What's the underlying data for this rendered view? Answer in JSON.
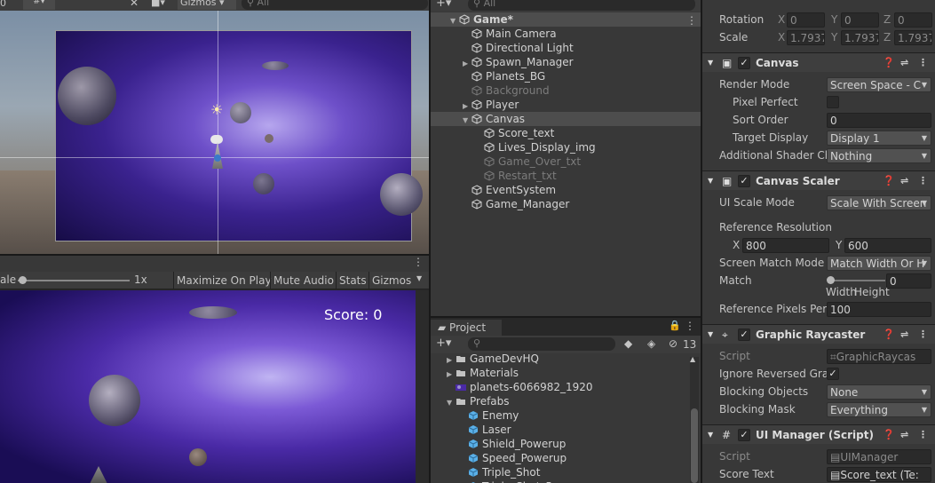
{
  "scene": {
    "toolbar": {
      "count": "0",
      "gizmos": "Gizmos"
    }
  },
  "game": {
    "toolbar": {
      "scale_prefix": "ale",
      "scale_value": "1x",
      "maximize": "Maximize On Play",
      "mute": "Mute Audio",
      "stats": "Stats",
      "gizmos": "Gizmos"
    },
    "score": "Score: 0"
  },
  "hierarchy": {
    "search_placeholder": "All",
    "items": [
      {
        "label": "Game*",
        "depth": 0
      },
      {
        "label": "Main Camera",
        "depth": 1
      },
      {
        "label": "Directional Light",
        "depth": 1
      },
      {
        "label": "Spawn_Manager",
        "depth": 1
      },
      {
        "label": "Planets_BG",
        "depth": 1
      },
      {
        "label": "Background",
        "depth": 1
      },
      {
        "label": "Player",
        "depth": 1
      },
      {
        "label": "Canvas",
        "depth": 1
      },
      {
        "label": "Score_text",
        "depth": 2
      },
      {
        "label": "Lives_Display_img",
        "depth": 2
      },
      {
        "label": "Game_Over_txt",
        "depth": 2
      },
      {
        "label": "Restart_txt",
        "depth": 2
      },
      {
        "label": "EventSystem",
        "depth": 1
      },
      {
        "label": "Game_Manager",
        "depth": 1
      }
    ]
  },
  "project": {
    "tab": "Project",
    "hidden_count": "13",
    "items": [
      {
        "label": "GameDevHQ"
      },
      {
        "label": "Materials"
      },
      {
        "label": "planets-6066982_1920"
      },
      {
        "label": "Prefabs"
      },
      {
        "label": "Enemy"
      },
      {
        "label": "Laser"
      },
      {
        "label": "Shield_Powerup"
      },
      {
        "label": "Speed_Powerup"
      },
      {
        "label": "Triple_Shot"
      },
      {
        "label": "Triple_Shot_Powerup"
      }
    ]
  },
  "inspector": {
    "rotation": {
      "label": "Rotation",
      "x": "0",
      "y": "0",
      "z": "0"
    },
    "scale": {
      "label": "Scale",
      "x": "1.7937",
      "y": "1.7937",
      "z": "1.7937"
    },
    "axis": {
      "x": "X",
      "y": "Y",
      "z": "Z"
    },
    "canvas": {
      "title": "Canvas",
      "render_mode_label": "Render Mode",
      "render_mode": "Screen Space - C",
      "pixel_perfect_label": "Pixel Perfect",
      "sort_order_label": "Sort Order",
      "sort_order": "0",
      "target_display_label": "Target Display",
      "target_display": "Display 1",
      "shader_label": "Additional Shader Ch",
      "shader": "Nothing"
    },
    "scaler": {
      "title": "Canvas Scaler",
      "mode_label": "UI Scale Mode",
      "mode": "Scale With Screen",
      "ref_label": "Reference Resolution",
      "ref_x": "800",
      "ref_y": "600",
      "match_mode_label": "Screen Match Mode",
      "match_mode": "Match Width Or H",
      "match_label": "Match",
      "match_value": "0",
      "match_level": 0.0,
      "width_label": "Width",
      "height_label": "Height",
      "ppu_label": "Reference Pixels Per",
      "ppu": "100"
    },
    "raycaster": {
      "title": "Graphic Raycaster",
      "script_label": "Script",
      "script": "GraphicRaycas",
      "ignore_label": "Ignore Reversed Grap",
      "blocking_objects_label": "Blocking Objects",
      "blocking_objects": "None",
      "blocking_mask_label": "Blocking Mask",
      "blocking_mask": "Everything"
    },
    "ui_manager": {
      "title": "UI Manager (Script)",
      "script_label": "Script",
      "script": "UIManager",
      "score_text_label": "Score Text",
      "score_text": "Score_text (Te:"
    }
  },
  "colors": {
    "accent_blue": "#3a79c9",
    "panel": "#383838",
    "selection": "#4d4d4d"
  }
}
